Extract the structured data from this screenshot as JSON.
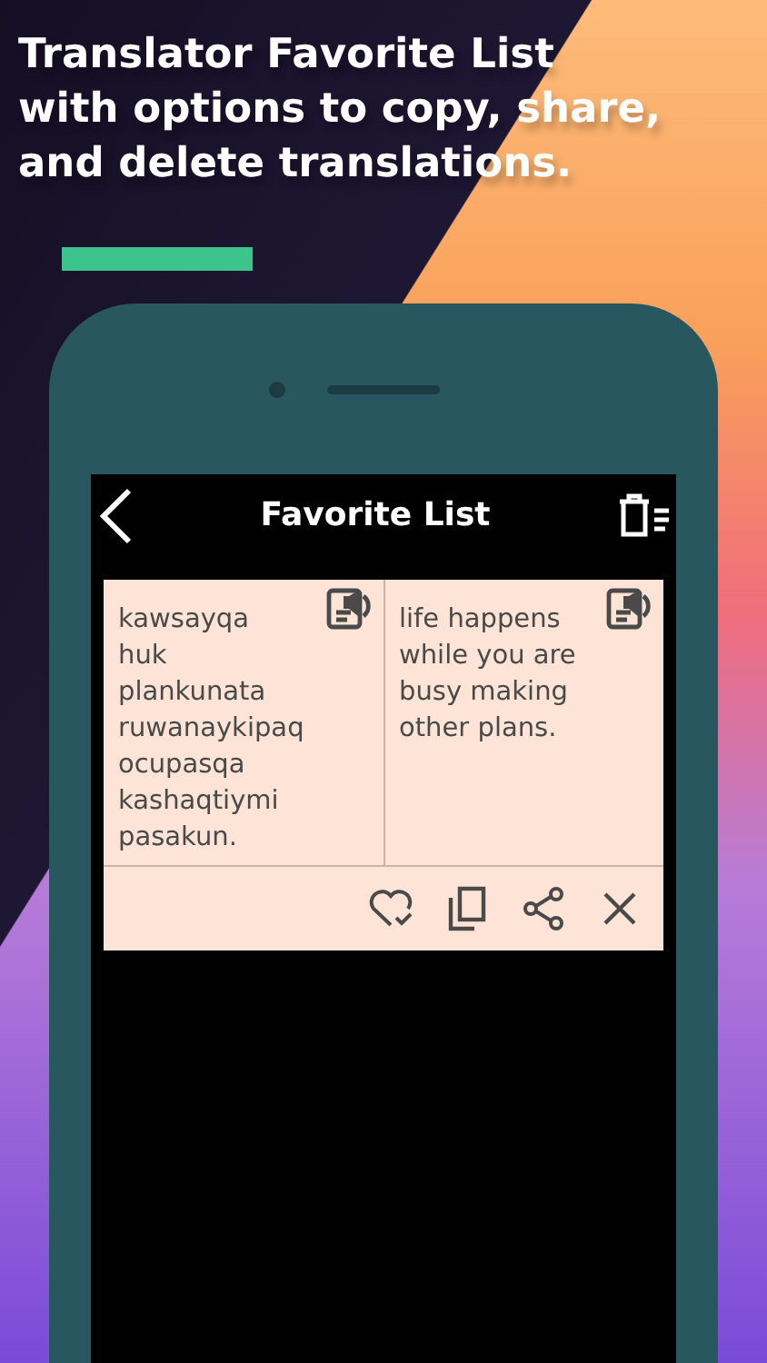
{
  "headline": "Translator Favorite List\nwith options to copy, share,\nand delete translations.",
  "app_bar": {
    "title": "Favorite List"
  },
  "favorites": [
    {
      "source": "kawsayqa\nhuk\nplankunata\nruwanaykipaq\nocupasqa\nkashaqtiymi\npasakun.",
      "translation": "life happens\nwhile you are\nbusy making\nother plans."
    }
  ]
}
